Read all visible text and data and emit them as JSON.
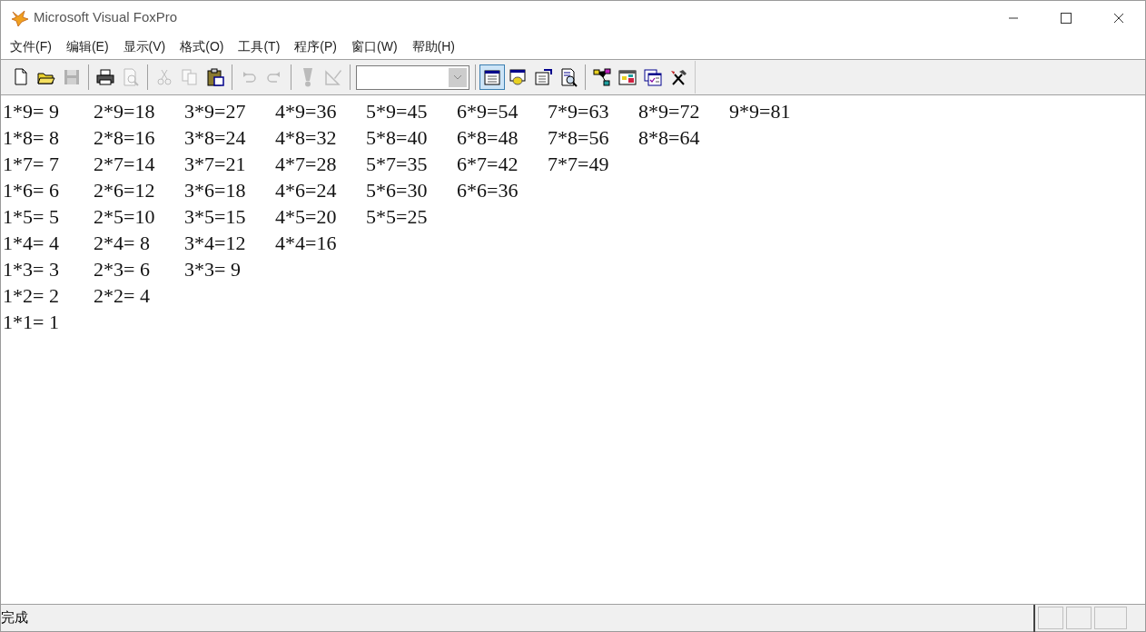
{
  "window": {
    "title": "Microsoft Visual FoxPro"
  },
  "menu": [
    "文件(F)",
    "编辑(E)",
    "显示(V)",
    "格式(O)",
    "工具(T)",
    "程序(P)",
    "窗口(W)",
    "帮助(H)"
  ],
  "toolbar": [
    {
      "kind": "button",
      "disabled": false,
      "selected": false
    },
    {
      "kind": "button",
      "disabled": false,
      "selected": false
    },
    {
      "kind": "button",
      "disabled": true,
      "selected": false
    },
    {
      "kind": "separator"
    },
    {
      "kind": "button",
      "disabled": false,
      "selected": false
    },
    {
      "kind": "button",
      "disabled": true,
      "selected": false
    },
    {
      "kind": "separator"
    },
    {
      "kind": "button",
      "disabled": true,
      "selected": false
    },
    {
      "kind": "button",
      "disabled": true,
      "selected": false
    },
    {
      "kind": "button",
      "disabled": false,
      "selected": false
    },
    {
      "kind": "separator"
    },
    {
      "kind": "button",
      "disabled": true,
      "selected": false
    },
    {
      "kind": "button",
      "disabled": true,
      "selected": false
    },
    {
      "kind": "separator"
    },
    {
      "kind": "button",
      "disabled": true,
      "selected": false
    },
    {
      "kind": "button",
      "disabled": true,
      "selected": false
    },
    {
      "kind": "separator"
    },
    {
      "kind": "combo"
    },
    {
      "kind": "separator"
    },
    {
      "kind": "button",
      "disabled": false,
      "selected": true
    },
    {
      "kind": "button",
      "disabled": false,
      "selected": false
    },
    {
      "kind": "button",
      "disabled": false,
      "selected": false
    },
    {
      "kind": "button",
      "disabled": false,
      "selected": false
    },
    {
      "kind": "separator"
    },
    {
      "kind": "button",
      "disabled": false,
      "selected": false
    },
    {
      "kind": "button",
      "disabled": false,
      "selected": false
    },
    {
      "kind": "button",
      "disabled": false,
      "selected": false
    },
    {
      "kind": "button",
      "disabled": false,
      "selected": false
    }
  ],
  "output": [
    [
      "1*9= 9",
      "2*9=18",
      "3*9=27",
      "4*9=36",
      "5*9=45",
      "6*9=54",
      "7*9=63",
      "8*9=72",
      "9*9=81"
    ],
    [
      "1*8= 8",
      "2*8=16",
      "3*8=24",
      "4*8=32",
      "5*8=40",
      "6*8=48",
      "7*8=56",
      "8*8=64"
    ],
    [
      "1*7= 7",
      "2*7=14",
      "3*7=21",
      "4*7=28",
      "5*7=35",
      "6*7=42",
      "7*7=49"
    ],
    [
      "1*6= 6",
      "2*6=12",
      "3*6=18",
      "4*6=24",
      "5*6=30",
      "6*6=36"
    ],
    [
      "1*5= 5",
      "2*5=10",
      "3*5=15",
      "4*5=20",
      "5*5=25"
    ],
    [
      "1*4= 4",
      "2*4= 8",
      "3*4=12",
      "4*4=16"
    ],
    [
      "1*3= 3",
      "2*3= 6",
      "3*3= 9"
    ],
    [
      "1*2= 2",
      "2*2= 4"
    ],
    [
      "1*1= 1"
    ]
  ],
  "status_bar": {
    "text": "完成"
  }
}
